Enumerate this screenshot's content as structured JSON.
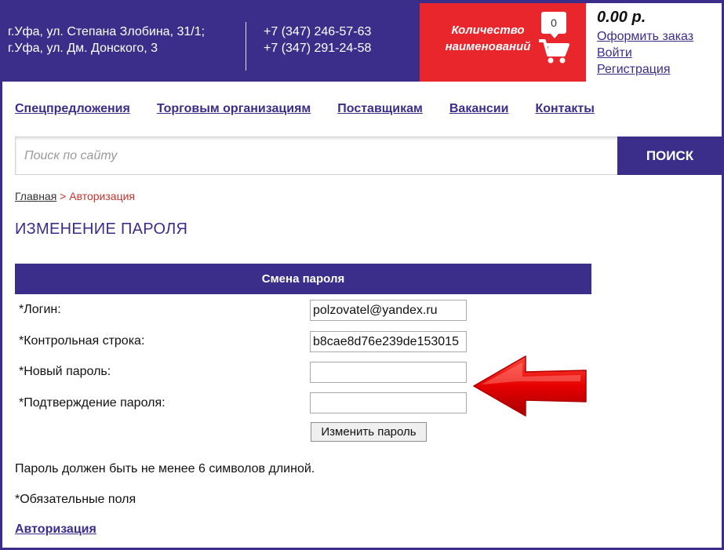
{
  "header": {
    "address_line1": "г.Уфа, ул. Степана Злобина, 31/1;",
    "address_line2": "г.Уфа, ул. Дм. Донского, 3",
    "phone1": "+7 (347) 246-57-63",
    "phone2": "+7 (347) 291-24-58",
    "cart": {
      "label_line1": "Количество",
      "label_line2": "наименований",
      "count": "0",
      "icon": "cart-icon"
    },
    "account": {
      "price": "0.00 р.",
      "order_link": "Оформить заказ",
      "login_link": "Войти",
      "register_link": "Регистрация"
    }
  },
  "nav": {
    "items": [
      "Спецпредложения",
      "Торговым организациям",
      "Поставщикам",
      "Вакансии",
      "Контакты"
    ]
  },
  "search": {
    "placeholder": "Поиск по сайту",
    "button_label": "ПОИСК"
  },
  "breadcrumb": {
    "home": "Главная",
    "separator": " > ",
    "current": "Авторизация"
  },
  "page": {
    "title": "ИЗМЕНЕНИЕ ПАРОЛЯ"
  },
  "form": {
    "header": "Смена пароля",
    "login_label": "*Логин:",
    "login_value": "polzovatel@yandex.ru",
    "checkword_label": "*Контрольная строка:",
    "checkword_value": "b8cae8d76e239de153015",
    "new_password_label": "*Новый пароль:",
    "new_password_value": "",
    "confirm_password_label": "*Подтверждение пароля:",
    "confirm_password_value": "",
    "submit_label": "Изменить пароль"
  },
  "notes": {
    "password_length": "Пароль должен быть не менее 6 символов длиной.",
    "required": "*Обязательные поля"
  },
  "footer": {
    "auth_link": "Авторизация"
  },
  "colors": {
    "brand": "#3b2d8a",
    "cart_red": "#e8262c",
    "arrow_red": "#e60000"
  }
}
